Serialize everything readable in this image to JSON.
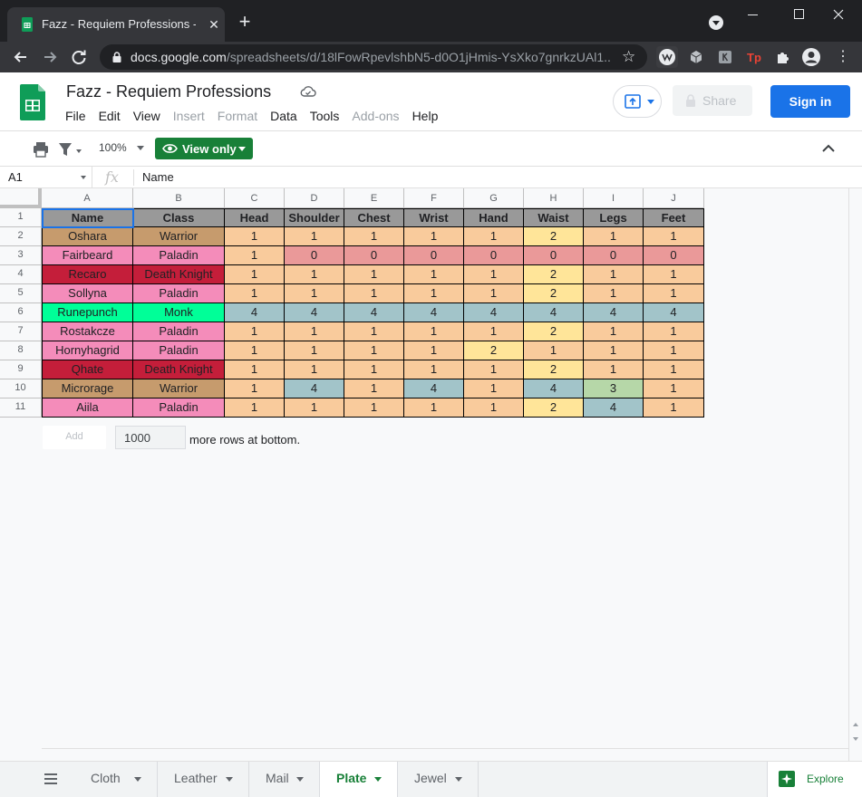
{
  "browser": {
    "tab_title": "Fazz - Requiem Professions - Goo",
    "url_host": "docs.google.com",
    "url_path": "/spreadsheets/d/18lFowRpevlshbN5-d0O1jHmis-YsXko7gnrkzUAl1..."
  },
  "doc": {
    "title": "Fazz - Requiem Professions",
    "menu": [
      {
        "label": "File",
        "disabled": false
      },
      {
        "label": "Edit",
        "disabled": false
      },
      {
        "label": "View",
        "disabled": false
      },
      {
        "label": "Insert",
        "disabled": true
      },
      {
        "label": "Format",
        "disabled": true
      },
      {
        "label": "Data",
        "disabled": false
      },
      {
        "label": "Tools",
        "disabled": false
      },
      {
        "label": "Add-ons",
        "disabled": true
      },
      {
        "label": "Help",
        "disabled": false
      }
    ],
    "share_label": "Share",
    "signin_label": "Sign in"
  },
  "toolbar": {
    "zoom": "100%",
    "view_only_label": "View only"
  },
  "formula_bar": {
    "cell_ref": "A1",
    "content": "Name"
  },
  "grid": {
    "columns": [
      "A",
      "B",
      "C",
      "D",
      "E",
      "F",
      "G",
      "H",
      "I",
      "J"
    ],
    "rows": [
      [
        "Name",
        "Class",
        "Head",
        "Shoulder",
        "Chest",
        "Wrist",
        "Hand",
        "Waist",
        "Legs",
        "Feet"
      ],
      [
        "Oshara",
        "Warrior",
        "1",
        "1",
        "1",
        "1",
        "1",
        "2",
        "1",
        "1"
      ],
      [
        "Fairbeard",
        "Paladin",
        "1",
        "0",
        "0",
        "0",
        "0",
        "0",
        "0",
        "0"
      ],
      [
        "Recaro",
        "Death Knight",
        "1",
        "1",
        "1",
        "1",
        "1",
        "2",
        "1",
        "1"
      ],
      [
        "Sollyna",
        "Paladin",
        "1",
        "1",
        "1",
        "1",
        "1",
        "2",
        "1",
        "1"
      ],
      [
        "Runepunch",
        "Monk",
        "4",
        "4",
        "4",
        "4",
        "4",
        "4",
        "4",
        "4"
      ],
      [
        "Rostakcze",
        "Paladin",
        "1",
        "1",
        "1",
        "1",
        "1",
        "2",
        "1",
        "1"
      ],
      [
        "Hornyhagrid",
        "Paladin",
        "1",
        "1",
        "1",
        "1",
        "2",
        "1",
        "1",
        "1"
      ],
      [
        "Qhate",
        "Death Knight",
        "1",
        "1",
        "1",
        "1",
        "1",
        "2",
        "1",
        "1"
      ],
      [
        "Microrage",
        "Warrior",
        "1",
        "4",
        "1",
        "4",
        "1",
        "4",
        "3",
        "1"
      ],
      [
        "Aiila",
        "Paladin",
        "1",
        "1",
        "1",
        "1",
        "1",
        "2",
        "4",
        "1"
      ]
    ],
    "add_label": "Add",
    "add_rows_value": "1000",
    "add_rows_suffix": "more rows at bottom."
  },
  "colors": {
    "header_bg": "#999999",
    "class": {
      "Warrior": "#c69b6d",
      "Paladin": "#f48cba",
      "Death Knight": "#c41e3a",
      "Monk": "#00ff98"
    },
    "value": {
      "0": "#ea9999",
      "1": "#f9cb9c",
      "2": "#ffe599",
      "3": "#b6d7a8",
      "4": "#a2c4c9"
    }
  },
  "sheet_tabs": [
    {
      "label": "Cloth",
      "active": false
    },
    {
      "label": "Leather",
      "active": false
    },
    {
      "label": "Mail",
      "active": false
    },
    {
      "label": "Plate",
      "active": true
    },
    {
      "label": "Jewel",
      "active": false
    }
  ],
  "explore_label": "Explore"
}
